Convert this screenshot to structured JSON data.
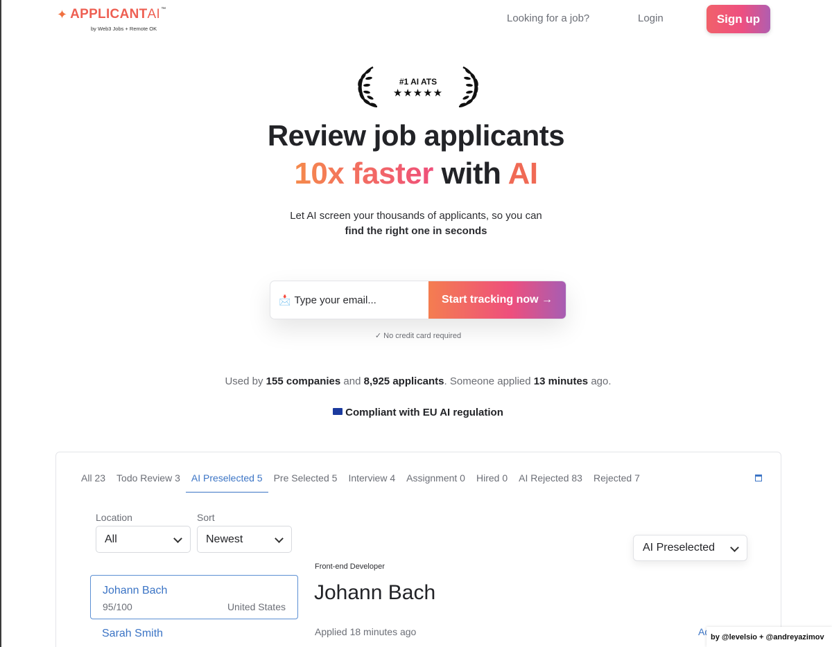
{
  "header": {
    "logo_brand": "APPLICANT",
    "logo_ai": "AI",
    "logo_tm": "™",
    "logo_subtitle": "by Web3 Jobs + Remote OK",
    "nav_job": "Looking for a job?",
    "nav_login": "Login",
    "signup": "Sign up"
  },
  "badge": {
    "title": "#1 AI ATS",
    "stars": "★★★★★"
  },
  "hero": {
    "line1": "Review job applicants",
    "line2_grad": "10x faster",
    "line2_mid": " with ",
    "line2_ai": "AI",
    "sub1": "Let AI screen your thousands of applicants, so you can",
    "sub2": "find the right one in seconds"
  },
  "form": {
    "email_placeholder": "Type your email...",
    "cta": "Start tracking now →",
    "note": "✓ No credit card required"
  },
  "stats": {
    "p1": "Used by ",
    "companies": "155 companies",
    "p2": " and ",
    "applicants": "8,925 applicants",
    "p3": ". Someone applied ",
    "time": "13 minutes",
    "p4": " ago."
  },
  "eu": {
    "text": "Compliant with EU AI regulation"
  },
  "demo": {
    "tabs": [
      "All 23",
      "Todo Review 3",
      "AI Preselected 5",
      "Pre Selected 5",
      "Interview 4",
      "Assignment 0",
      "Hired 0",
      "AI Rejected 83",
      "Rejected 7"
    ],
    "active_tab": 2,
    "location_label": "Location",
    "location_value": "All",
    "sort_label": "Sort",
    "sort_value": "Newest",
    "status_value": "AI Preselected",
    "applicants": [
      {
        "name": "Johann Bach",
        "score": "95/100",
        "location": "United States"
      },
      {
        "name": "Sarah Smith",
        "score": "",
        "location": ""
      }
    ],
    "detail": {
      "role": "Front-end Developer",
      "name": "Johann Bach",
      "applied": "Applied 18 minutes ago",
      "link_partial": "Ad"
    }
  },
  "credit": "by @levelsio + @andreyazimov",
  "colors": {
    "accent_blue": "#3b74c5",
    "brand_coral": "#ee5f52"
  }
}
